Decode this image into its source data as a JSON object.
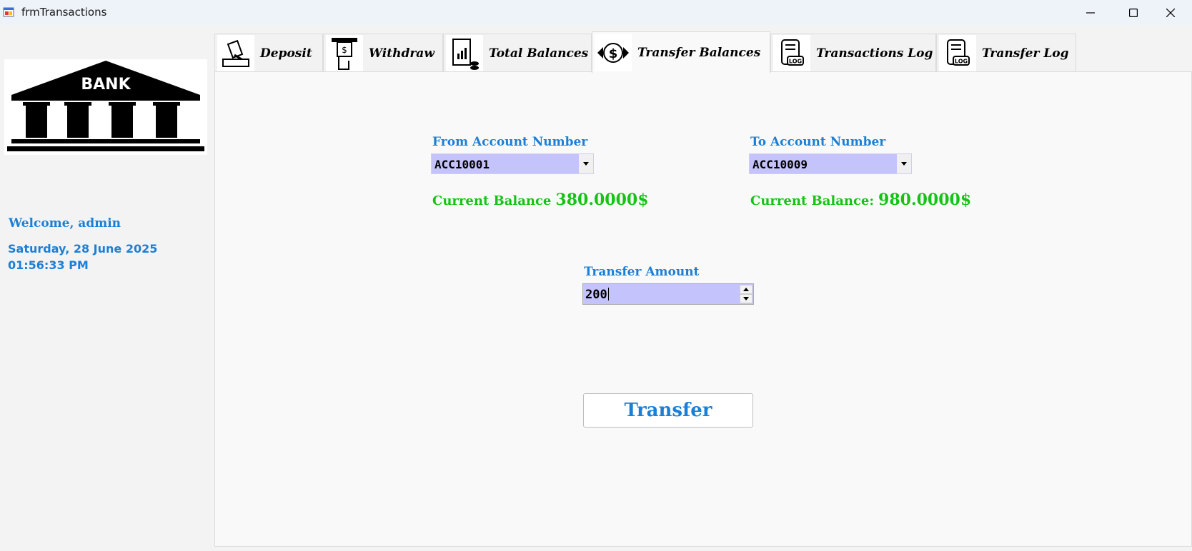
{
  "window": {
    "title": "frmTransactions",
    "icon": "app-form-icon",
    "controls": [
      "minimize-icon",
      "maximize-icon",
      "close-icon"
    ]
  },
  "sidebar": {
    "logo_text": "BANK",
    "welcome": "Welcome, admin",
    "date": "Saturday, 28 June 2025",
    "time": "01:56:33 PM"
  },
  "tabs": [
    {
      "label": "Deposit",
      "icon": "deposit-icon",
      "active": false
    },
    {
      "label": "Withdraw",
      "icon": "atm-withdraw-icon",
      "active": false
    },
    {
      "label": "Total Balances",
      "icon": "report-chart-icon",
      "active": false
    },
    {
      "label": "Transfer Balances",
      "icon": "dollar-transfer-icon",
      "active": true
    },
    {
      "label": "Transactions Log",
      "icon": "log-document-icon",
      "active": false
    },
    {
      "label": "Transfer Log",
      "icon": "log-document-icon",
      "active": false
    }
  ],
  "transfer": {
    "from": {
      "label": "From Account Number",
      "value": "ACC10001",
      "balance_label": "Current Balance",
      "balance_value": "380.0000$"
    },
    "to": {
      "label": "To Account Number",
      "value": "ACC10009",
      "balance_label": "Current Balance:",
      "balance_value": "980.0000$"
    },
    "amount_label": "Transfer Amount",
    "amount_value": "200",
    "button_label": "Transfer"
  },
  "colors": {
    "accent": "#1a7fd6",
    "balance_green": "#14c314",
    "input_bg": "#c5c3fb"
  }
}
